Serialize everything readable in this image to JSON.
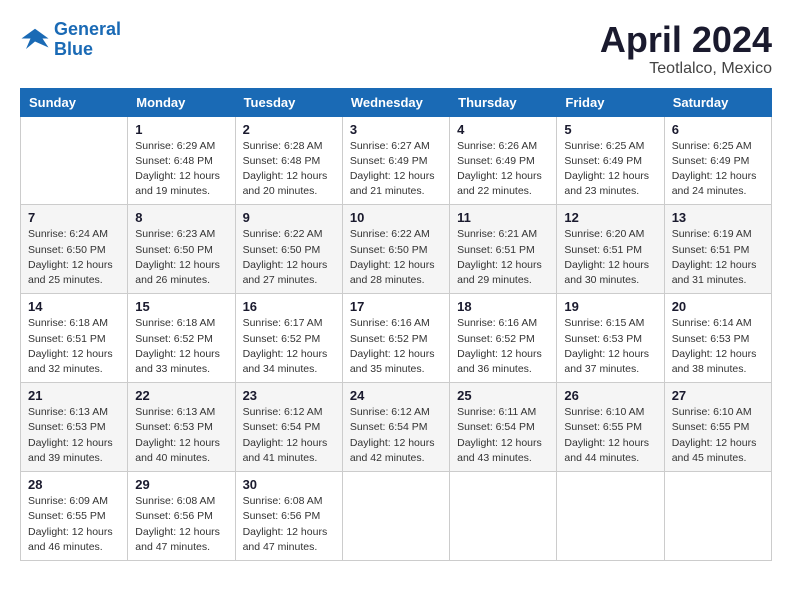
{
  "header": {
    "logo_line1": "General",
    "logo_line2": "Blue",
    "month": "April 2024",
    "location": "Teotlalco, Mexico"
  },
  "days_of_week": [
    "Sunday",
    "Monday",
    "Tuesday",
    "Wednesday",
    "Thursday",
    "Friday",
    "Saturday"
  ],
  "weeks": [
    [
      {
        "day": "",
        "info": ""
      },
      {
        "day": "1",
        "info": "Sunrise: 6:29 AM\nSunset: 6:48 PM\nDaylight: 12 hours\nand 19 minutes."
      },
      {
        "day": "2",
        "info": "Sunrise: 6:28 AM\nSunset: 6:48 PM\nDaylight: 12 hours\nand 20 minutes."
      },
      {
        "day": "3",
        "info": "Sunrise: 6:27 AM\nSunset: 6:49 PM\nDaylight: 12 hours\nand 21 minutes."
      },
      {
        "day": "4",
        "info": "Sunrise: 6:26 AM\nSunset: 6:49 PM\nDaylight: 12 hours\nand 22 minutes."
      },
      {
        "day": "5",
        "info": "Sunrise: 6:25 AM\nSunset: 6:49 PM\nDaylight: 12 hours\nand 23 minutes."
      },
      {
        "day": "6",
        "info": "Sunrise: 6:25 AM\nSunset: 6:49 PM\nDaylight: 12 hours\nand 24 minutes."
      }
    ],
    [
      {
        "day": "7",
        "info": "Sunrise: 6:24 AM\nSunset: 6:50 PM\nDaylight: 12 hours\nand 25 minutes."
      },
      {
        "day": "8",
        "info": "Sunrise: 6:23 AM\nSunset: 6:50 PM\nDaylight: 12 hours\nand 26 minutes."
      },
      {
        "day": "9",
        "info": "Sunrise: 6:22 AM\nSunset: 6:50 PM\nDaylight: 12 hours\nand 27 minutes."
      },
      {
        "day": "10",
        "info": "Sunrise: 6:22 AM\nSunset: 6:50 PM\nDaylight: 12 hours\nand 28 minutes."
      },
      {
        "day": "11",
        "info": "Sunrise: 6:21 AM\nSunset: 6:51 PM\nDaylight: 12 hours\nand 29 minutes."
      },
      {
        "day": "12",
        "info": "Sunrise: 6:20 AM\nSunset: 6:51 PM\nDaylight: 12 hours\nand 30 minutes."
      },
      {
        "day": "13",
        "info": "Sunrise: 6:19 AM\nSunset: 6:51 PM\nDaylight: 12 hours\nand 31 minutes."
      }
    ],
    [
      {
        "day": "14",
        "info": "Sunrise: 6:18 AM\nSunset: 6:51 PM\nDaylight: 12 hours\nand 32 minutes."
      },
      {
        "day": "15",
        "info": "Sunrise: 6:18 AM\nSunset: 6:52 PM\nDaylight: 12 hours\nand 33 minutes."
      },
      {
        "day": "16",
        "info": "Sunrise: 6:17 AM\nSunset: 6:52 PM\nDaylight: 12 hours\nand 34 minutes."
      },
      {
        "day": "17",
        "info": "Sunrise: 6:16 AM\nSunset: 6:52 PM\nDaylight: 12 hours\nand 35 minutes."
      },
      {
        "day": "18",
        "info": "Sunrise: 6:16 AM\nSunset: 6:52 PM\nDaylight: 12 hours\nand 36 minutes."
      },
      {
        "day": "19",
        "info": "Sunrise: 6:15 AM\nSunset: 6:53 PM\nDaylight: 12 hours\nand 37 minutes."
      },
      {
        "day": "20",
        "info": "Sunrise: 6:14 AM\nSunset: 6:53 PM\nDaylight: 12 hours\nand 38 minutes."
      }
    ],
    [
      {
        "day": "21",
        "info": "Sunrise: 6:13 AM\nSunset: 6:53 PM\nDaylight: 12 hours\nand 39 minutes."
      },
      {
        "day": "22",
        "info": "Sunrise: 6:13 AM\nSunset: 6:53 PM\nDaylight: 12 hours\nand 40 minutes."
      },
      {
        "day": "23",
        "info": "Sunrise: 6:12 AM\nSunset: 6:54 PM\nDaylight: 12 hours\nand 41 minutes."
      },
      {
        "day": "24",
        "info": "Sunrise: 6:12 AM\nSunset: 6:54 PM\nDaylight: 12 hours\nand 42 minutes."
      },
      {
        "day": "25",
        "info": "Sunrise: 6:11 AM\nSunset: 6:54 PM\nDaylight: 12 hours\nand 43 minutes."
      },
      {
        "day": "26",
        "info": "Sunrise: 6:10 AM\nSunset: 6:55 PM\nDaylight: 12 hours\nand 44 minutes."
      },
      {
        "day": "27",
        "info": "Sunrise: 6:10 AM\nSunset: 6:55 PM\nDaylight: 12 hours\nand 45 minutes."
      }
    ],
    [
      {
        "day": "28",
        "info": "Sunrise: 6:09 AM\nSunset: 6:55 PM\nDaylight: 12 hours\nand 46 minutes."
      },
      {
        "day": "29",
        "info": "Sunrise: 6:08 AM\nSunset: 6:56 PM\nDaylight: 12 hours\nand 47 minutes."
      },
      {
        "day": "30",
        "info": "Sunrise: 6:08 AM\nSunset: 6:56 PM\nDaylight: 12 hours\nand 47 minutes."
      },
      {
        "day": "",
        "info": ""
      },
      {
        "day": "",
        "info": ""
      },
      {
        "day": "",
        "info": ""
      },
      {
        "day": "",
        "info": ""
      }
    ]
  ]
}
